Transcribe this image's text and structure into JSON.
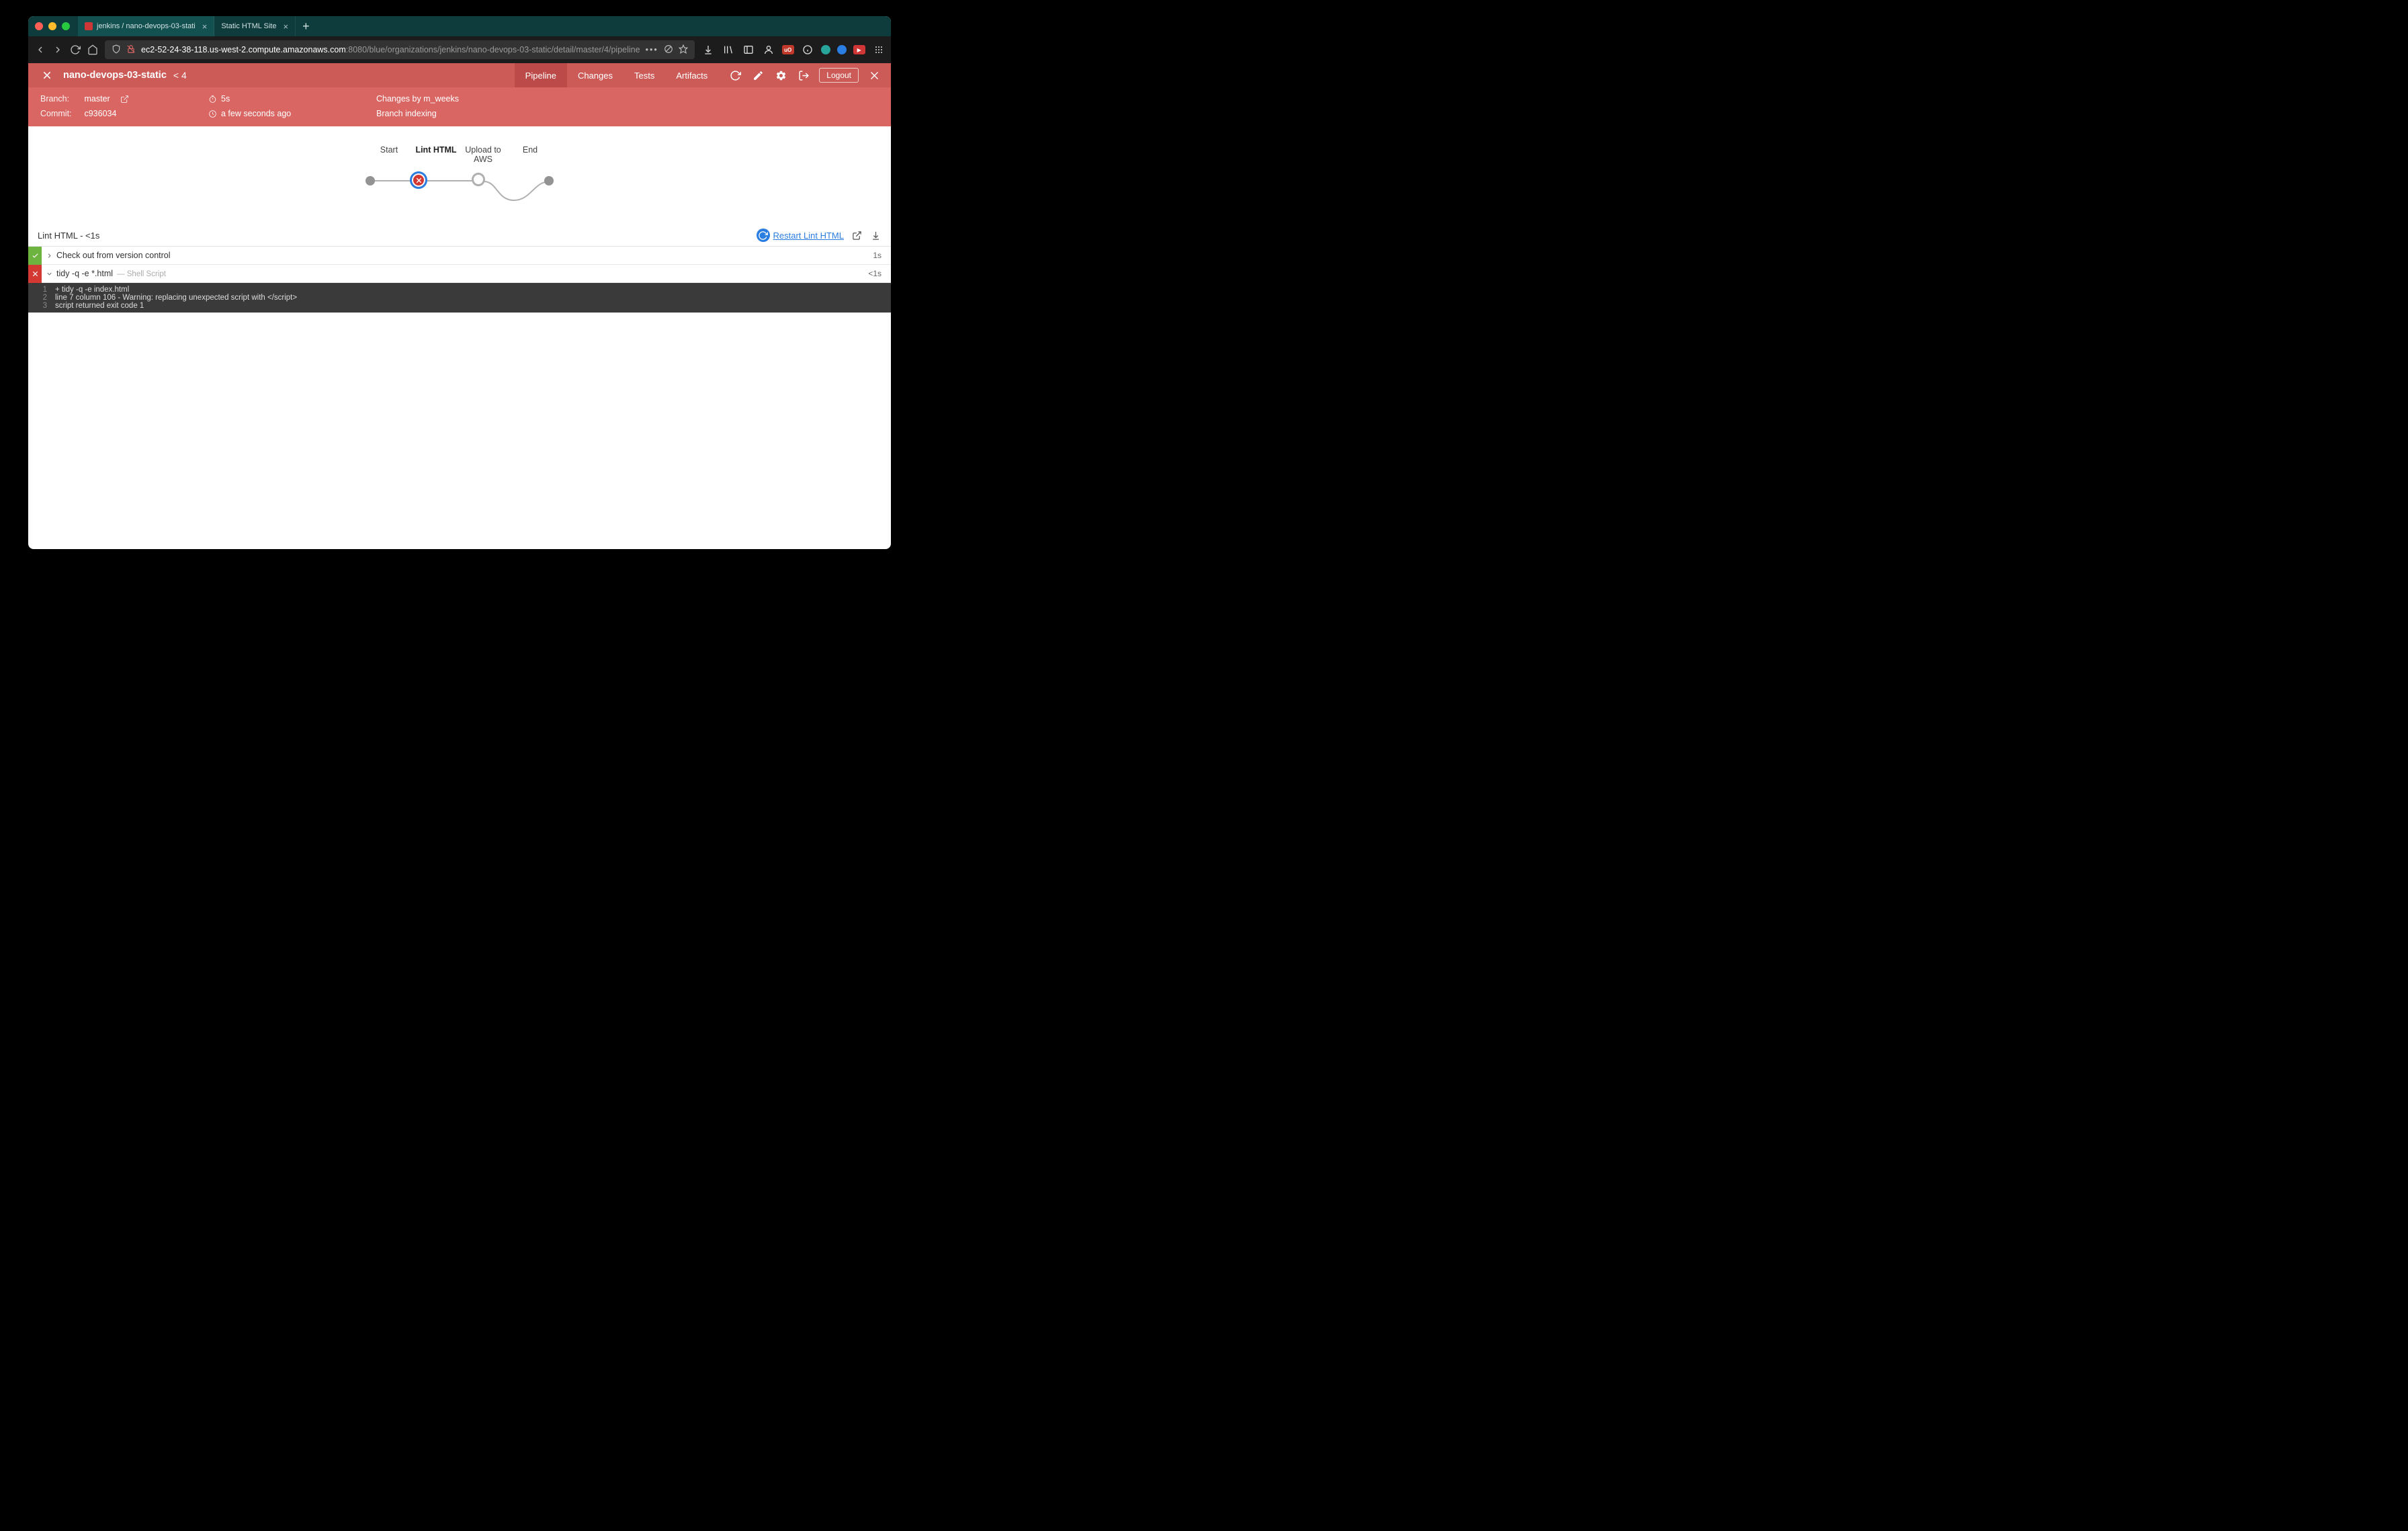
{
  "browser": {
    "tabs": [
      {
        "title": "jenkins / nano-devops-03-stati",
        "active": true
      },
      {
        "title": "Static HTML Site",
        "active": false
      }
    ],
    "url_host": "ec2-52-24-38-118.us-west-2.compute.amazonaws.com",
    "url_rest": ":8080/blue/organizations/jenkins/nano-devops-03-static/detail/master/4/pipeline",
    "ext_badge1": "uO",
    "ext_badge2": "▶"
  },
  "header": {
    "title": "nano-devops-03-static",
    "run_prefix": "<",
    "run_number": "4",
    "tabs": [
      "Pipeline",
      "Changes",
      "Tests",
      "Artifacts"
    ],
    "active_tab": "Pipeline",
    "logout": "Logout"
  },
  "info": {
    "branch_label": "Branch:",
    "branch_value": "master",
    "duration": "5s",
    "changes_by": "Changes by m_weeks",
    "commit_label": "Commit:",
    "commit_value": "c936034",
    "age": "a few seconds ago",
    "cause": "Branch indexing"
  },
  "stages": {
    "items": [
      "Start",
      "Lint HTML",
      "Upload to AWS",
      "End"
    ],
    "active": "Lint HTML"
  },
  "section": {
    "title": "Lint HTML - <1s",
    "restart": "Restart Lint HTML"
  },
  "steps": [
    {
      "status": "ok",
      "expanded": false,
      "name": "Check out from version control",
      "sub": "",
      "time": "1s"
    },
    {
      "status": "fail",
      "expanded": true,
      "name": "tidy -q -e *.html",
      "sub": "— Shell Script",
      "time": "<1s"
    }
  ],
  "console": [
    "+ tidy -q -e index.html",
    "line 7 column 106 - Warning: replacing unexpected script with </script>",
    "script returned exit code 1"
  ]
}
